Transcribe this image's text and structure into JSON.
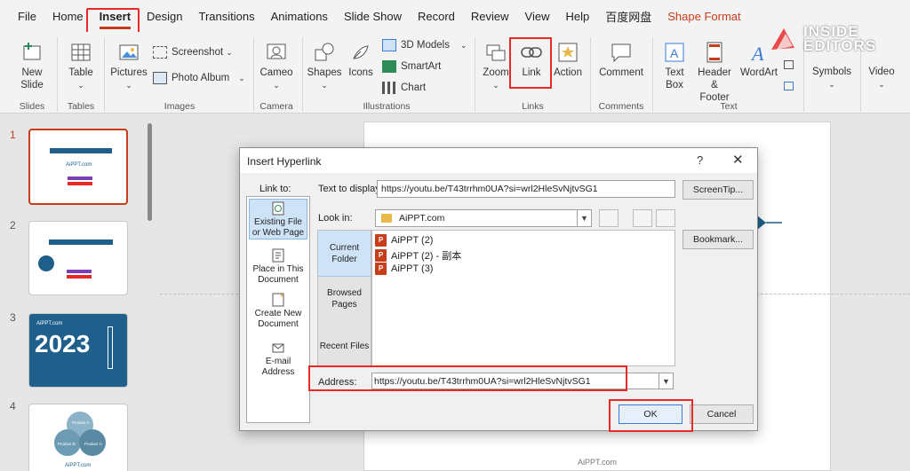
{
  "menu": {
    "tabs": [
      "File",
      "Home",
      "Insert",
      "Design",
      "Transitions",
      "Animations",
      "Slide Show",
      "Record",
      "Review",
      "View",
      "Help",
      "百度网盘",
      "Shape Format"
    ],
    "active": "Insert"
  },
  "ribbon": {
    "new_slide": "New Slide",
    "new_slide_arrow": "⌄",
    "table": "Table",
    "pictures": "Pictures",
    "screenshot": "Screenshot",
    "photo_album": "Photo Album",
    "cameo": "Cameo",
    "shapes": "Shapes",
    "icons": "Icons",
    "models_3d": "3D Models",
    "smartart": "SmartArt",
    "chart": "Chart",
    "zoom": "Zoom",
    "link": "Link",
    "action": "Action",
    "comment": "Comment",
    "text_box": "Text Box",
    "header_footer": "Header & Footer",
    "wordart": "WordArt",
    "symbols": "Symbols",
    "video": "Video",
    "groups": {
      "slides": "Slides",
      "tables": "Tables",
      "images": "Images",
      "camera": "Camera",
      "illustrations": "Illustrations",
      "links": "Links",
      "comments": "Comments",
      "text": "Text"
    }
  },
  "logo": {
    "line1": "INSIDE",
    "line2": "EDITORS"
  },
  "thumbnails": [
    {
      "num": "1",
      "brand": "AiPPT.com"
    },
    {
      "num": "2",
      "brand": ""
    },
    {
      "num": "3",
      "brand": "AiPPT.com",
      "year": "2023"
    },
    {
      "num": "4",
      "brand": "AiPPT.com",
      "labels": [
        "Product A",
        "Product B",
        "Product C"
      ]
    }
  ],
  "slide": {
    "brand": "AiPPT.com"
  },
  "dialog": {
    "title": "Insert Hyperlink",
    "help": "?",
    "close": "✕",
    "link_to_label": "Link to:",
    "link_to_items": [
      "Existing File or Web Page",
      "Place in This Document",
      "Create New Document",
      "E-mail Address"
    ],
    "text_to_display_label": "Text to display:",
    "text_to_display_value": "https://youtu.be/T43trrhm0UA?si=wrl2HleSvNjtvSG1",
    "screentip_button": "ScreenTip...",
    "look_in_label": "Look in:",
    "look_in_value": "AiPPT.com",
    "nav_items": [
      "Current Folder",
      "Browsed Pages",
      "Recent Files"
    ],
    "files": [
      "AiPPT (2)",
      "AiPPT (2) - 副本",
      "AiPPT (3)"
    ],
    "bookmark_button": "Bookmark...",
    "address_label": "Address:",
    "address_value": "https://youtu.be/T43trrhm0UA?si=wrl2HleSvNjtvSG1",
    "ok_button": "OK",
    "cancel_button": "Cancel"
  }
}
